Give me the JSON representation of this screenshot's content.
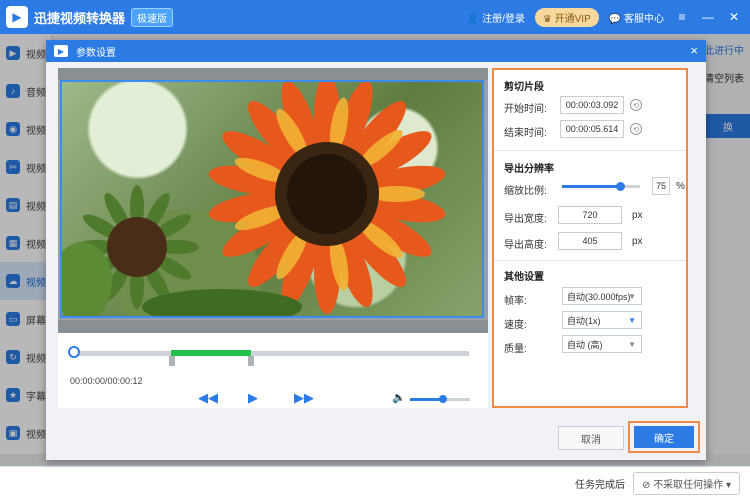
{
  "app": {
    "name": "迅捷视频转换器",
    "edition": "极速版",
    "login": "注册/登录",
    "vip": "开通VIP",
    "service": "客服中心"
  },
  "sidebar": {
    "items": [
      {
        "label": "视频"
      },
      {
        "label": "音频"
      },
      {
        "label": "视频"
      },
      {
        "label": "视频"
      },
      {
        "label": "视频"
      },
      {
        "label": "视频"
      },
      {
        "label": "视频"
      },
      {
        "label": "屏幕"
      },
      {
        "label": "视频"
      },
      {
        "label": "字幕"
      },
      {
        "label": "视频"
      }
    ]
  },
  "background": {
    "link_fragment": "y此进行中",
    "clear_list": "清空列表",
    "partial_button": "换",
    "after_task_label": "任务完成后",
    "after_task_value": "不采取任何操作"
  },
  "dialog": {
    "title": "参数设置",
    "close": "×",
    "cancel": "取消",
    "confirm": "确定"
  },
  "player": {
    "time": "00:00:00/00:00:12",
    "trim_start_fraction": 0.25,
    "trim_end_fraction": 0.45,
    "playhead_fraction": 0.0,
    "volume_fraction": 0.55
  },
  "settings": {
    "trim": {
      "heading": "剪切片段",
      "start_label": "开始时间:",
      "start_value": "00:00:03.092",
      "end_label": "结束时间:",
      "end_value": "00:00:05.614"
    },
    "resolution": {
      "heading": "导出分辨率",
      "scale_label": "缩放比例:",
      "scale_value": "75",
      "scale_unit": "%",
      "scale_fraction": 0.75,
      "width_label": "导出宽度:",
      "width_value": "720",
      "height_label": "导出高度:",
      "height_value": "405",
      "px_unit": "px"
    },
    "other": {
      "heading": "其他设置",
      "fps_label": "帧率:",
      "fps_value": "自动(30.000fps)",
      "speed_label": "速度:",
      "speed_value": "自动(1x)",
      "quality_label": "质量:",
      "quality_value": "自动 (高)"
    }
  }
}
